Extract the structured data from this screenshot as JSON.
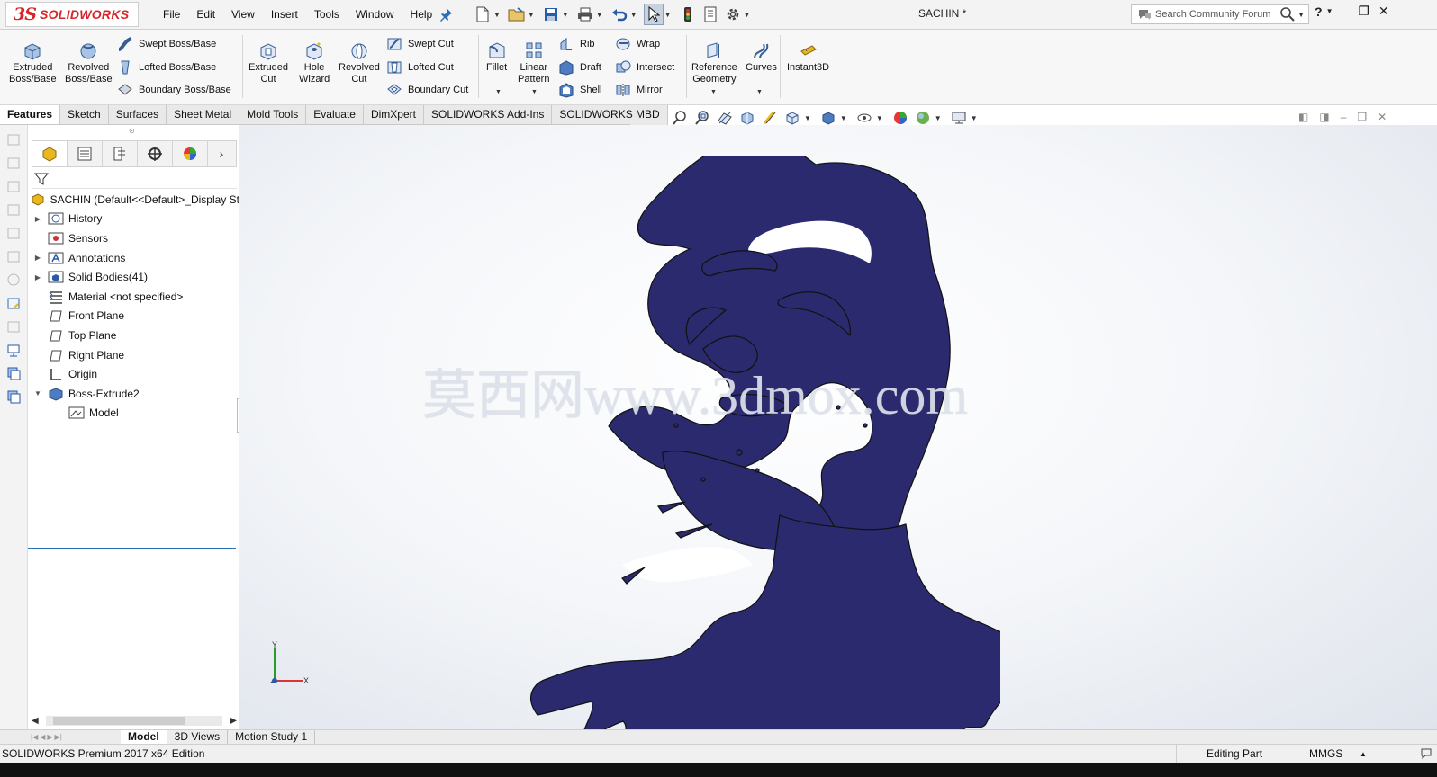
{
  "app": {
    "brand_prefix": "3S",
    "brand": "SOLIDWORKS",
    "document_title": "SACHIN *"
  },
  "menu": [
    "File",
    "Edit",
    "View",
    "Insert",
    "Tools",
    "Window",
    "Help"
  ],
  "search": {
    "placeholder": "Search Community Forum"
  },
  "window_controls": {
    "help": "?",
    "minimize": "–",
    "restore": "❐",
    "close": "✕"
  },
  "features_toolbar": {
    "extruded_boss": [
      "Extruded",
      "Boss/Base"
    ],
    "revolved_boss": [
      "Revolved",
      "Boss/Base"
    ],
    "swept_boss": "Swept Boss/Base",
    "lofted_boss": "Lofted Boss/Base",
    "boundary_boss": "Boundary Boss/Base",
    "extruded_cut": [
      "Extruded",
      "Cut"
    ],
    "hole_wizard": [
      "Hole",
      "Wizard"
    ],
    "revolved_cut": [
      "Revolved",
      "Cut"
    ],
    "swept_cut": "Swept Cut",
    "lofted_cut": "Lofted Cut",
    "boundary_cut": "Boundary Cut",
    "fillet": "Fillet",
    "linear_pattern": [
      "Linear",
      "Pattern"
    ],
    "rib": "Rib",
    "draft": "Draft",
    "shell": "Shell",
    "wrap": "Wrap",
    "intersect": "Intersect",
    "mirror": "Mirror",
    "reference_geometry": [
      "Reference",
      "Geometry"
    ],
    "curves": "Curves",
    "instant3d": "Instant3D"
  },
  "command_tabs": [
    "Features",
    "Sketch",
    "Surfaces",
    "Sheet Metal",
    "Mold Tools",
    "Evaluate",
    "DimXpert",
    "SOLIDWORKS Add-Ins",
    "SOLIDWORKS MBD"
  ],
  "feature_tree": {
    "root": "SACHIN  (Default<<Default>_Display St",
    "items": [
      {
        "label": "History",
        "expandable": true
      },
      {
        "label": "Sensors",
        "expandable": false
      },
      {
        "label": "Annotations",
        "expandable": true
      },
      {
        "label": "Solid Bodies(41)",
        "expandable": true
      },
      {
        "label": "Material <not specified>",
        "expandable": false
      },
      {
        "label": "Front Plane",
        "expandable": false
      },
      {
        "label": "Top Plane",
        "expandable": false
      },
      {
        "label": "Right Plane",
        "expandable": false
      },
      {
        "label": "Origin",
        "expandable": false
      },
      {
        "label": "Boss-Extrude2",
        "expandable": true,
        "expanded": true
      },
      {
        "label": "Model",
        "child": true
      }
    ]
  },
  "watermark": "莫西网www.3dmox.com",
  "triad": {
    "y": "Y",
    "x": "X"
  },
  "bottom_tabs": [
    "Model",
    "3D Views",
    "Motion Study 1"
  ],
  "status": {
    "edition": "SOLIDWORKS Premium 2017 x64 Edition",
    "mode": "Editing Part",
    "units": "MMGS"
  },
  "colors": {
    "model": "#2b2a6e",
    "brand": "#d7252a",
    "accent": "#2a6fb8"
  }
}
